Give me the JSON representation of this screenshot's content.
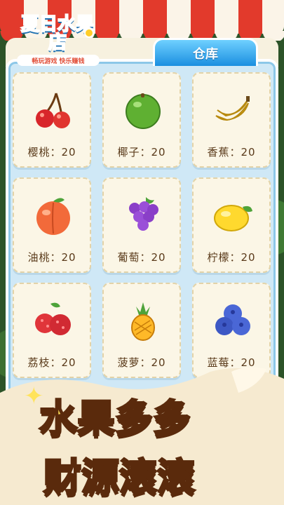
{
  "header": {
    "logo_title": "夏日水果店",
    "logo_subtitle": "畅玩游戏 快乐赚钱",
    "tab_label": "仓库"
  },
  "items": [
    {
      "label": "樱桃：20",
      "icon": "cherry-icon"
    },
    {
      "label": "椰子：20",
      "icon": "coconut-icon"
    },
    {
      "label": "香蕉：20",
      "icon": "banana-icon"
    },
    {
      "label": "油桃：20",
      "icon": "nectarine-icon"
    },
    {
      "label": "葡萄：20",
      "icon": "grape-icon"
    },
    {
      "label": "柠檬：20",
      "icon": "lemon-icon"
    },
    {
      "label": "荔枝：20",
      "icon": "lychee-icon"
    },
    {
      "label": "菠萝：20",
      "icon": "pineapple-icon"
    },
    {
      "label": "蓝莓：20",
      "icon": "blueberry-icon"
    }
  ],
  "banner": {
    "line1": "水果多多",
    "line2": "财源滚滚"
  }
}
